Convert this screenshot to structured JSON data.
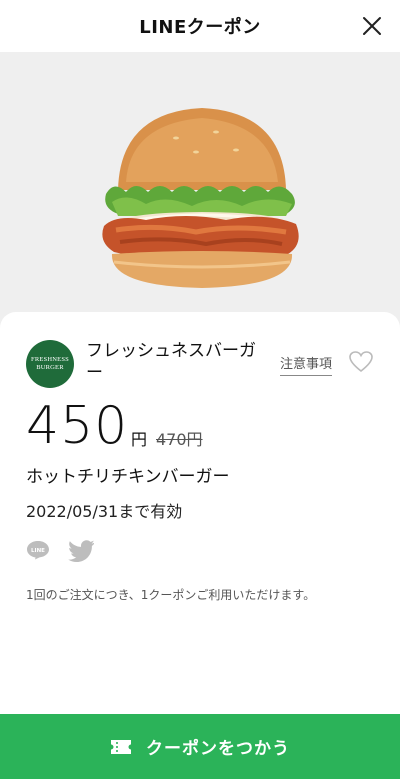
{
  "header": {
    "title": "LINEクーポン",
    "close_icon": "close-icon"
  },
  "hero": {
    "image": "burger-photo"
  },
  "shop": {
    "name": "フレッシュネスバーガー",
    "logo_line1": "FRESHNESS",
    "logo_line2": "BURGER",
    "logo_color": "#1f6b3a"
  },
  "notice_link": "注意事項",
  "favorite_icon": "heart-icon",
  "price": {
    "value": "450",
    "unit": "円",
    "original": "470円"
  },
  "product_name": "ホットチリチキンバーガー",
  "valid_until": "2022/05/31まで有効",
  "share": {
    "line_icon": "line-icon",
    "twitter_icon": "twitter-icon"
  },
  "note": "1回のご注文につき、1クーポンご利用いただけます。",
  "use_button": {
    "label": "クーポンをつかう",
    "icon": "ticket-icon",
    "color": "#2bb359"
  }
}
